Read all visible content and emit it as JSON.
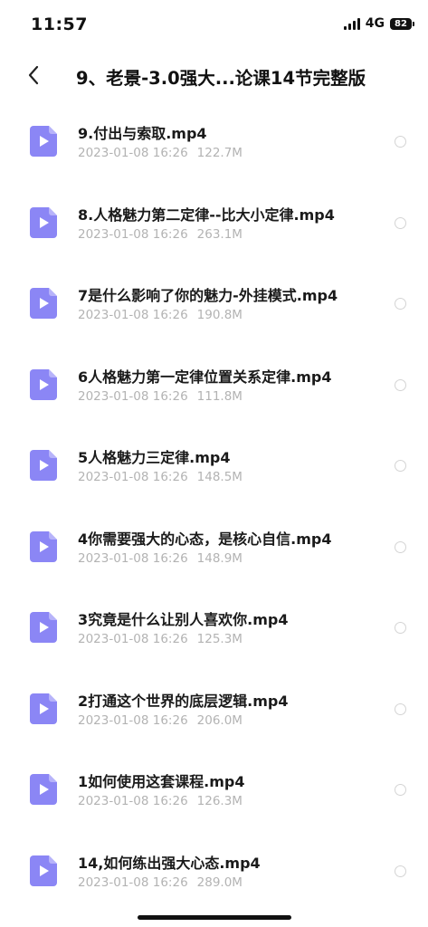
{
  "status": {
    "time": "11:57",
    "network": "4G",
    "battery": "82"
  },
  "nav": {
    "title": "9、老景-3.0强大...论课14节完整版"
  },
  "files": [
    {
      "name": "9.付出与索取.mp4",
      "date": "2023-01-08 16:26",
      "size": "122.7M"
    },
    {
      "name": "8.人格魅力第二定律--比大小定律.mp4",
      "date": "2023-01-08 16:26",
      "size": "263.1M"
    },
    {
      "name": "7是什么影响了你的魅力-外挂模式.mp4",
      "date": "2023-01-08 16:26",
      "size": "190.8M"
    },
    {
      "name": "6人格魅力第一定律位置关系定律.mp4",
      "date": "2023-01-08 16:26",
      "size": "111.8M"
    },
    {
      "name": "5人格魅力三定律.mp4",
      "date": "2023-01-08 16:26",
      "size": "148.5M"
    },
    {
      "name": "4你需要强大的心态，是核心自信.mp4",
      "date": "2023-01-08 16:26",
      "size": "148.9M"
    },
    {
      "name": "3究竟是什么让别人喜欢你.mp4",
      "date": "2023-01-08 16:26",
      "size": "125.3M"
    },
    {
      "name": "2打通这个世界的底层逻辑.mp4",
      "date": "2023-01-08 16:26",
      "size": "206.0M"
    },
    {
      "name": "1如何使用这套课程.mp4",
      "date": "2023-01-08 16:26",
      "size": "126.3M"
    },
    {
      "name": "14,如何练出强大心态.mp4",
      "date": "2023-01-08 16:26",
      "size": "289.0M"
    }
  ],
  "icons": {
    "back": "chevron-left-icon",
    "file": "video-file-icon",
    "select": "radio-circle-icon"
  },
  "colors": {
    "file_icon": "#8b86f5",
    "meta_text": "#b3b3b3",
    "radio_border": "#d4d4d4"
  }
}
